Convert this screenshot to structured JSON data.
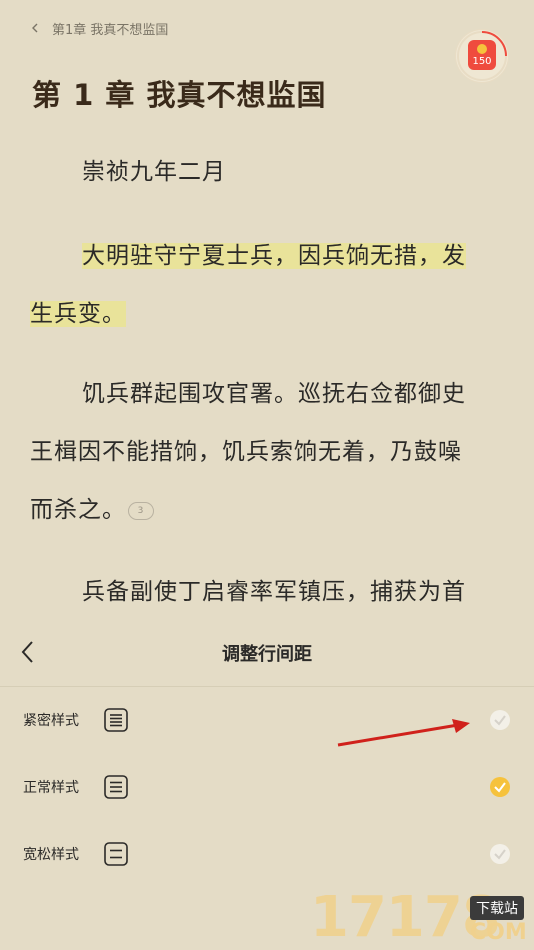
{
  "header": {
    "breadcrumb": "第1章 我真不想监国",
    "reward_count": "150"
  },
  "chapter": {
    "title": "第 1 章 我真不想监国",
    "p1": "崇祯九年二月",
    "p2_line1": "大明驻守宁夏士兵，因兵饷无措，发",
    "p2_line2": "生兵变。",
    "p3_line1": "饥兵群起围攻官署。巡抚右佥都御史",
    "p3_line2": "王楫因不能措饷，饥兵索饷无着，乃鼓噪",
    "p3_line3": "而杀之。",
    "comment_count": "3",
    "p4_line1": "兵备副使丁启睿率军镇压，捕获为首"
  },
  "panel": {
    "title": "调整行间距",
    "options": [
      {
        "label": "紧密样式",
        "icon": "dense-lines-icon",
        "selected": false
      },
      {
        "label": "正常样式",
        "icon": "normal-lines-icon",
        "selected": true
      },
      {
        "label": "宽松样式",
        "icon": "loose-lines-icon",
        "selected": false
      }
    ]
  },
  "watermark": {
    "number": "17178",
    "tag": "下载站",
    "domain": "COM"
  },
  "colors": {
    "background": "#e4dcc6",
    "highlight": "#e9e39a",
    "accent": "#f6c23c",
    "reward": "#ef4b3e",
    "annotation_arrow": "#d0211b"
  }
}
